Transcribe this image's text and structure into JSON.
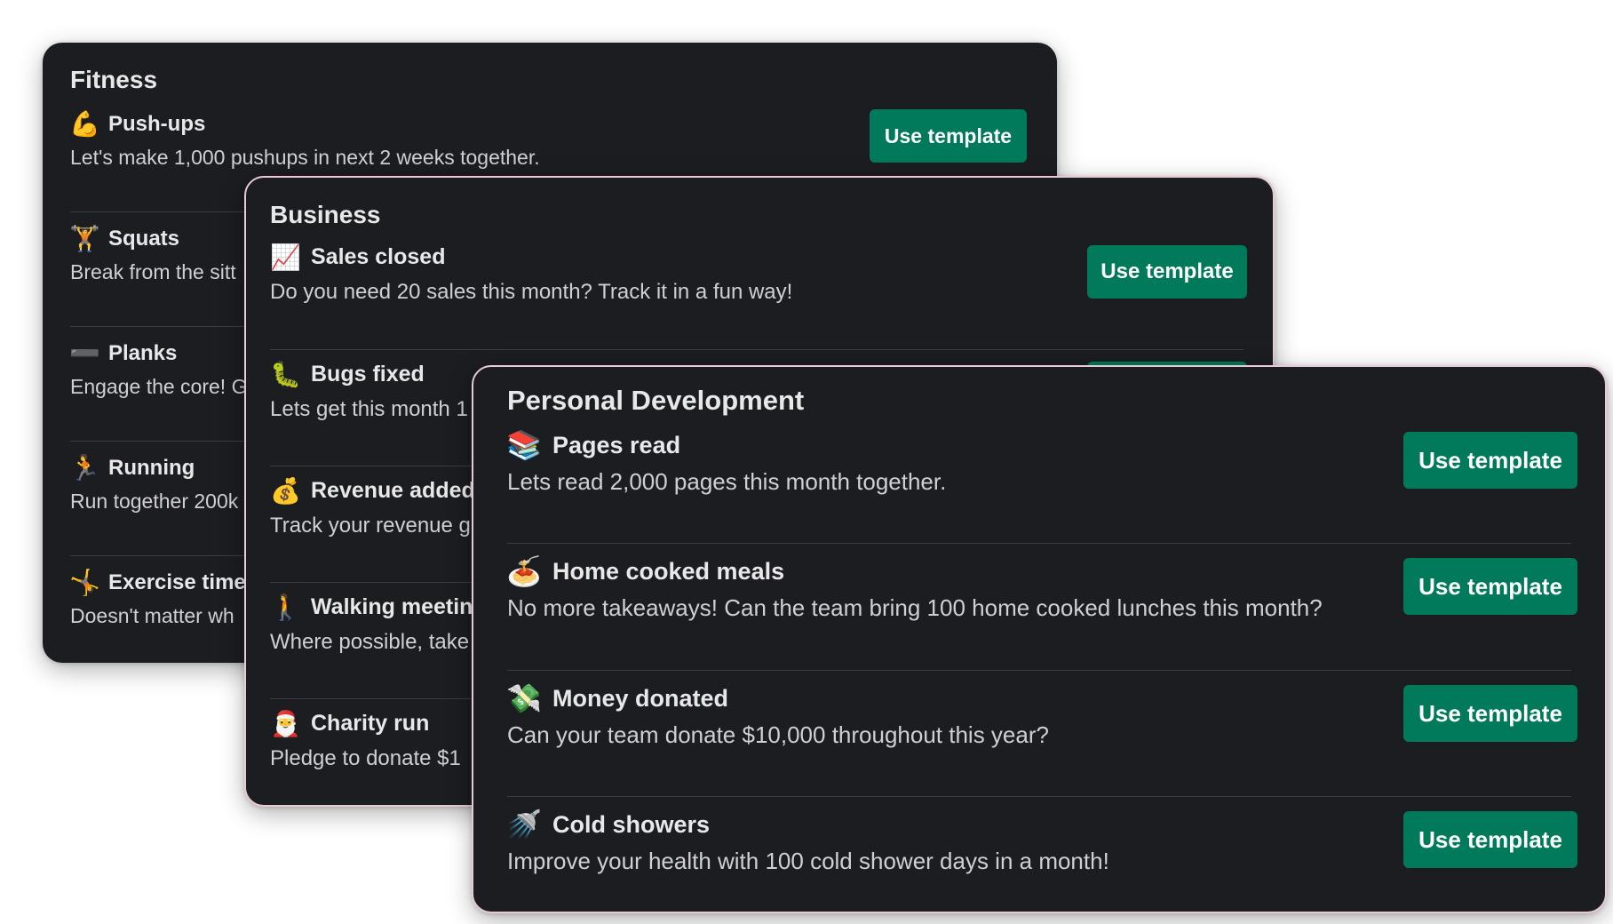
{
  "fitness": {
    "title": "Fitness",
    "button_label": "Use template",
    "items": [
      {
        "emoji": "💪",
        "title": "Push-ups",
        "desc": "Let's make 1,000 pushups in next 2 weeks together."
      },
      {
        "emoji": "🏋️",
        "title": "Squats",
        "desc": "Break from the sitt"
      },
      {
        "emoji": "➖",
        "title": "Planks",
        "desc": "Engage the core! G"
      },
      {
        "emoji": "🏃",
        "title": "Running",
        "desc": "Run together 200k"
      },
      {
        "emoji": "🤸",
        "title": "Exercise time",
        "desc": "Doesn't matter wh"
      }
    ]
  },
  "business": {
    "title": "Business",
    "button_label": "Use template",
    "items": [
      {
        "emoji": "📈",
        "title": "Sales closed",
        "desc": "Do you need 20 sales this month? Track it in a fun way!"
      },
      {
        "emoji": "🐛",
        "title": "Bugs fixed",
        "desc": "Lets get this month 1"
      },
      {
        "emoji": "💰",
        "title": "Revenue added",
        "desc": "Track your revenue g"
      },
      {
        "emoji": "🚶",
        "title": "Walking meeting",
        "desc": "Where possible, take"
      },
      {
        "emoji": "🎅",
        "title": "Charity run",
        "desc": "Pledge to donate $1"
      }
    ]
  },
  "personal": {
    "title": "Personal Development",
    "button_label": "Use template",
    "items": [
      {
        "emoji": "📚",
        "title": "Pages read",
        "desc": "Lets read 2,000 pages this month together."
      },
      {
        "emoji": "🍝",
        "title": "Home cooked meals",
        "desc": "No more takeaways! Can the team bring 100 home cooked lunches this month?"
      },
      {
        "emoji": "💸",
        "title": "Money donated",
        "desc": "Can your team donate $10,000 throughout this year?"
      },
      {
        "emoji": "🚿",
        "title": "Cold showers",
        "desc": "Improve your health with 100 cold shower days in a month!"
      }
    ]
  },
  "colors": {
    "card_bg": "#1b1d21",
    "button_bg": "#007a5a",
    "title_text": "#e8e8e8",
    "body_text": "#d0d0d2",
    "divider": "#3b3d42"
  }
}
